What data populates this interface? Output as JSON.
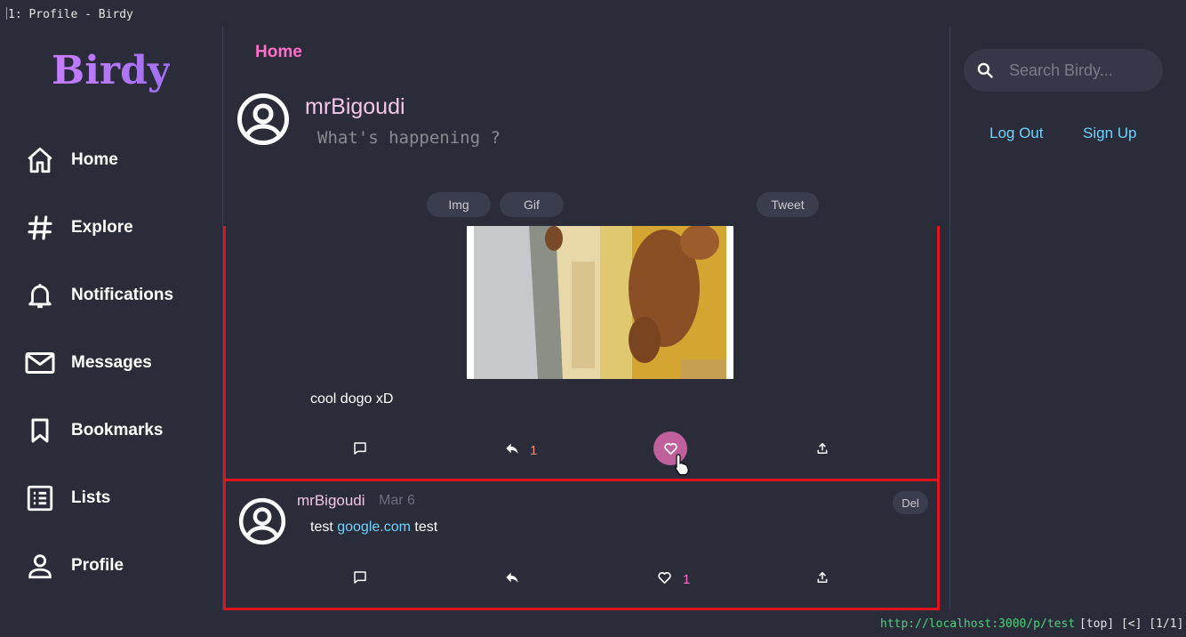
{
  "window": {
    "title": "1: Profile - Birdy"
  },
  "sidebar": {
    "logo": "Birdy",
    "items": [
      {
        "label": "Home",
        "icon": "home-icon"
      },
      {
        "label": "Explore",
        "icon": "hashtag-icon"
      },
      {
        "label": "Notifications",
        "icon": "bell-icon"
      },
      {
        "label": "Messages",
        "icon": "envelope-icon"
      },
      {
        "label": "Bookmarks",
        "icon": "bookmark-icon"
      },
      {
        "label": "Lists",
        "icon": "list-icon"
      },
      {
        "label": "Profile",
        "icon": "user-icon"
      }
    ]
  },
  "main": {
    "title": "Home",
    "composer": {
      "username": "mrBigoudi",
      "placeholder": "What's happening ?",
      "img_label": "Img",
      "gif_label": "Gif",
      "tweet_label": "Tweet"
    },
    "posts": [
      {
        "text": "cool dogo xD",
        "reply_count": "1",
        "liked": true
      },
      {
        "username": "mrBigoudi",
        "date": "Mar 6",
        "text_before": "test ",
        "link": "google.com",
        "text_after": " test",
        "like_count": "1",
        "delete_label": "Del"
      }
    ]
  },
  "right": {
    "search_placeholder": "Search Birdy...",
    "logout_label": "Log Out",
    "signup_label": "Sign Up"
  },
  "status_bar": {
    "url": "http://localhost:3000/p/test",
    "position": "[top] [<] [1/1]"
  },
  "colors": {
    "background": "#2a2c3a",
    "accent_pink": "#ff6ec7",
    "username_pink": "#f3c6ea",
    "link_blue": "#6fd3ff",
    "post_border": "#e0141c",
    "like_active": "#c0609c",
    "reply_count": "#ff8a73"
  }
}
